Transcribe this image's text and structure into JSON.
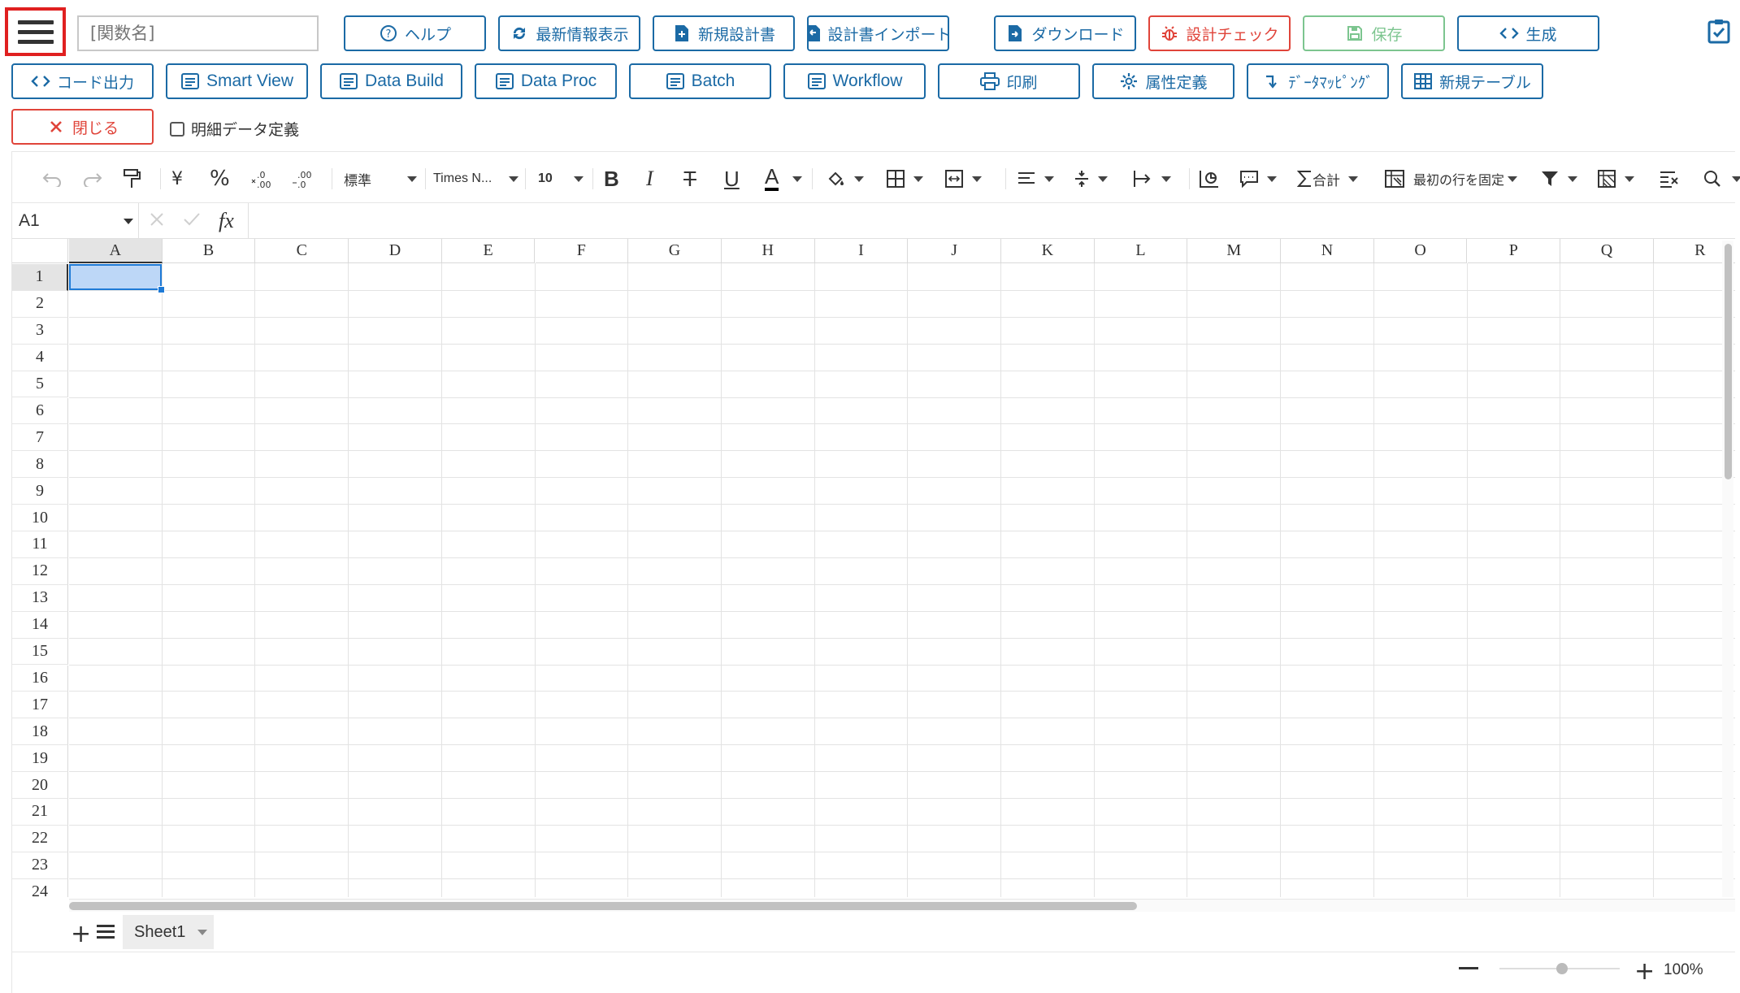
{
  "toolbar": {
    "menu_icon": "hamburger-menu-icon",
    "function_name_placeholder": "[関数名]",
    "row1": [
      {
        "label": "ヘルプ",
        "icon": "help-circle-icon"
      },
      {
        "label": "最新情報表示",
        "icon": "refresh-icon"
      },
      {
        "label": "新規設計書",
        "icon": "new-document-icon"
      },
      {
        "label": "設計書インポート",
        "icon": "import-document-icon"
      },
      {
        "label": "ダウンロード",
        "icon": "download-document-icon"
      },
      {
        "label": "設計チェック",
        "icon": "bug-icon"
      },
      {
        "label": "保存",
        "icon": "save-icon"
      },
      {
        "label": "生成",
        "icon": "code-icon"
      }
    ],
    "row2": [
      {
        "label": "コード出力",
        "icon": "code-icon"
      },
      {
        "label": "Smart View",
        "icon": "list-icon"
      },
      {
        "label": "Data Build",
        "icon": "list-icon"
      },
      {
        "label": "Data Proc",
        "icon": "list-icon"
      },
      {
        "label": "Batch",
        "icon": "list-icon"
      },
      {
        "label": "Workflow",
        "icon": "list-icon"
      },
      {
        "label": "印刷",
        "icon": "print-icon"
      },
      {
        "label": "属性定義",
        "icon": "gear-icon"
      },
      {
        "label": "ﾃﾞｰﾀﾏｯﾋﾟﾝｸﾞ",
        "icon": "mapping-arrow-icon"
      },
      {
        "label": "新規テーブル",
        "icon": "table-icon"
      }
    ],
    "close_label": "閉じる",
    "detail_checkbox_label": "明細データ定義",
    "detail_checkbox_checked": false,
    "top_right_icon": "clipboard-check-icon"
  },
  "ribbon": {
    "number_format": "標準",
    "font_name": "Times N...",
    "font_size": "10",
    "currency_symbol": "¥",
    "percent_symbol": "%",
    "sum_label": "合計",
    "freeze_label": "最初の行を固定"
  },
  "formula_bar": {
    "cell_ref": "A1",
    "fx_label": "fx",
    "formula": ""
  },
  "sheet": {
    "columns": [
      "A",
      "B",
      "C",
      "D",
      "E",
      "F",
      "G",
      "H",
      "I",
      "J",
      "K",
      "L",
      "M",
      "N",
      "O",
      "P",
      "Q",
      "R"
    ],
    "rows": [
      "1",
      "2",
      "3",
      "4",
      "5",
      "6",
      "7",
      "8",
      "9",
      "10",
      "11",
      "12",
      "13",
      "14",
      "15",
      "16",
      "17",
      "18",
      "19",
      "20",
      "21",
      "22",
      "23",
      "24"
    ],
    "selected_cell": "A1"
  },
  "tabs": {
    "sheets": [
      "Sheet1"
    ],
    "active": "Sheet1"
  },
  "zoom": {
    "value": 1.0,
    "label": "100%"
  },
  "colors": {
    "primary": "#1b6aa5",
    "danger": "#e0443a",
    "success": "#7cc58f",
    "selection_fill": "#bdd7f7",
    "selection_border": "#1e7ad6",
    "menu_highlight": "#e02020"
  }
}
